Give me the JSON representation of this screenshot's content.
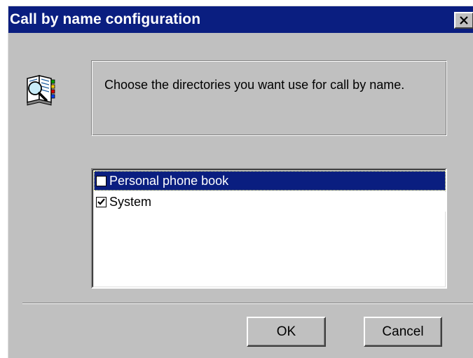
{
  "window": {
    "title": "Call by name configuration",
    "close_icon": "close-x-icon"
  },
  "message": {
    "icon": "directory-book-icon",
    "text": "Choose the directories you want use for call by name."
  },
  "directories": {
    "items": [
      {
        "label": "Personal phone book",
        "checked": false,
        "selected": true
      },
      {
        "label": "System",
        "checked": true,
        "selected": false
      }
    ]
  },
  "buttons": {
    "ok_label": "OK",
    "cancel_label": "Cancel"
  },
  "colors": {
    "titlebar": "#0a1e80",
    "dialog_face": "#c0c0c0",
    "selection": "#0a1e80"
  }
}
